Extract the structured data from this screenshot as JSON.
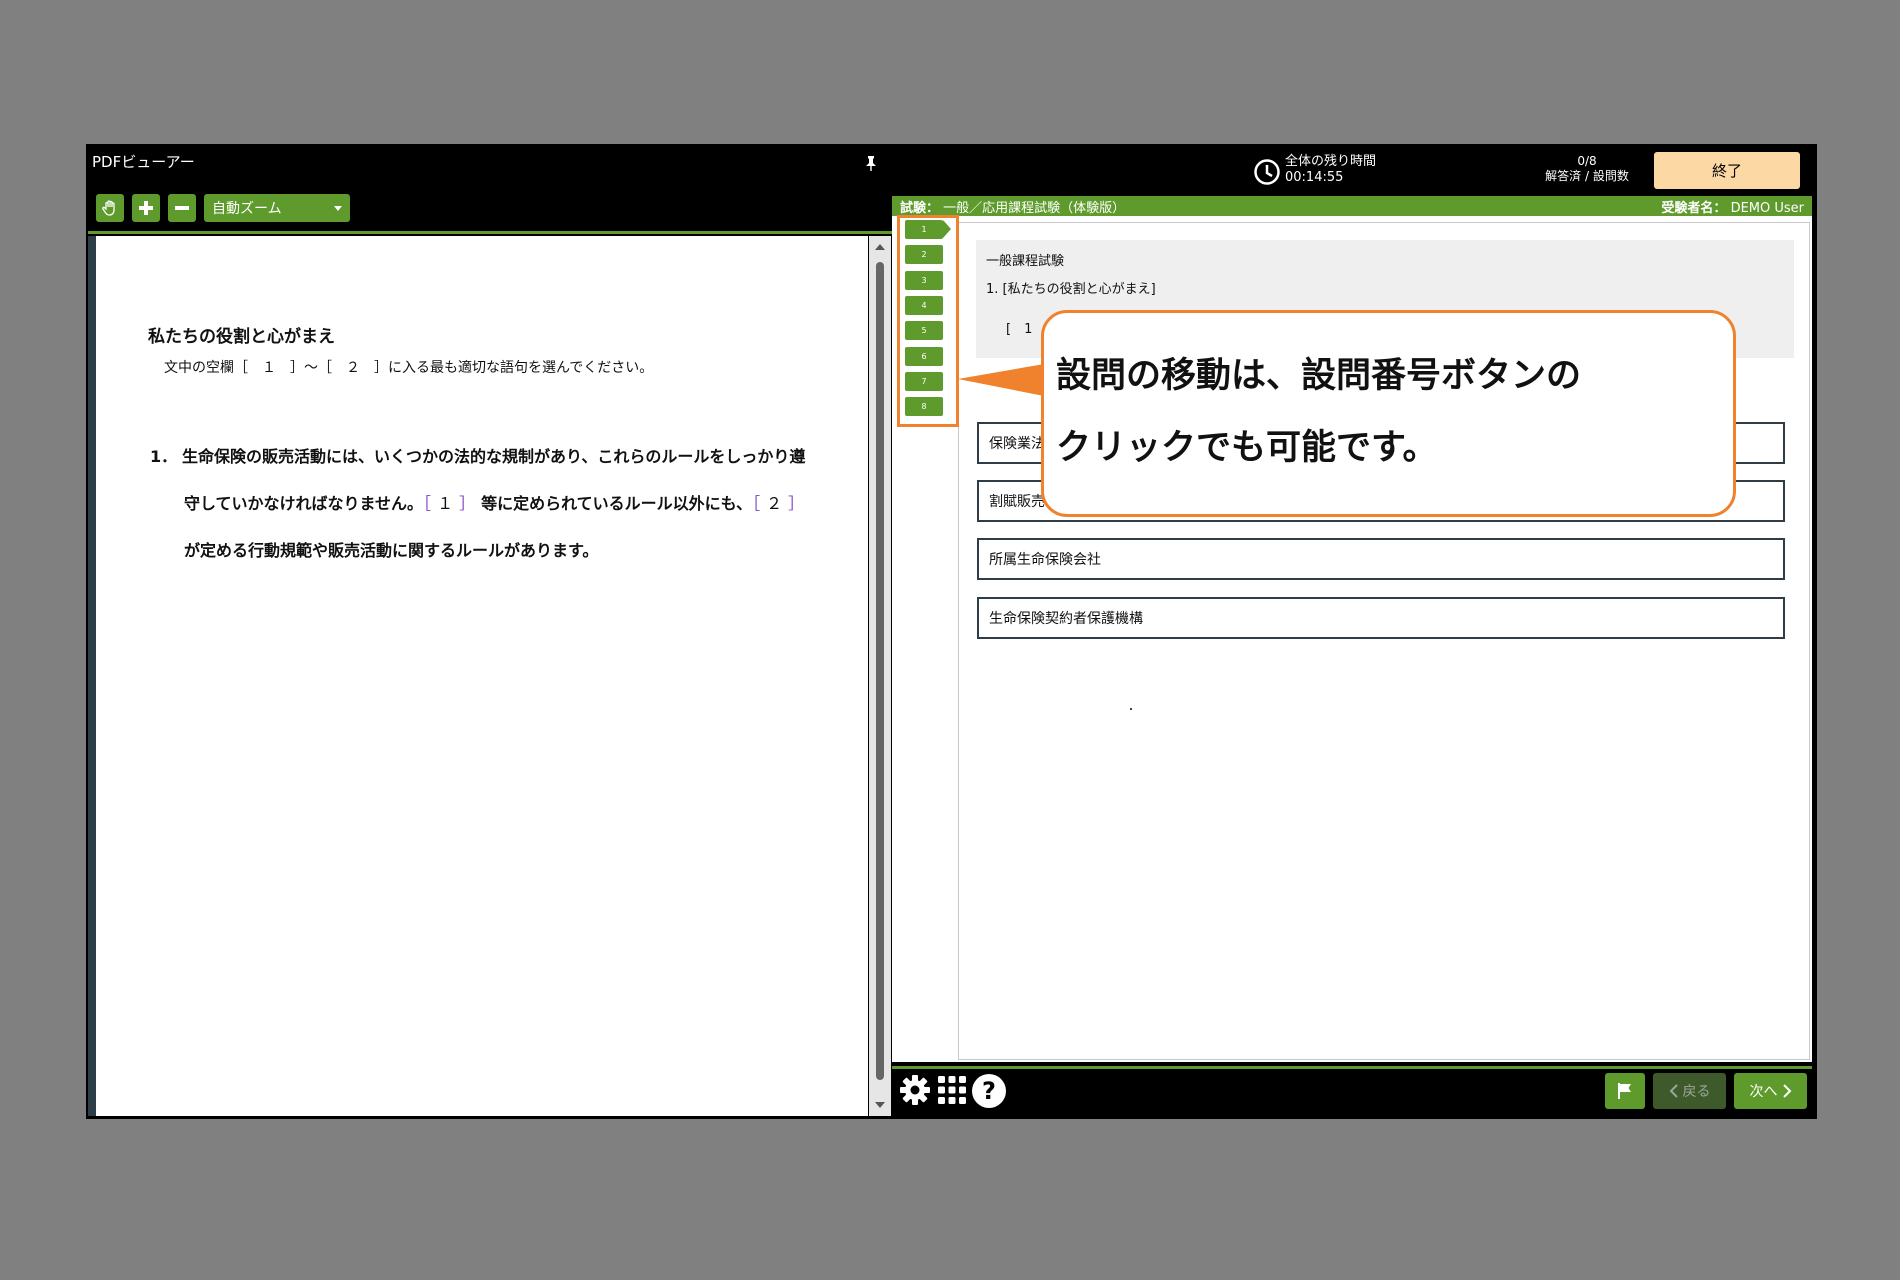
{
  "pdf_viewer": {
    "title": "PDFビューアー",
    "zoom_label": "自動ズーム"
  },
  "document": {
    "heading": "私たちの役割と心がまえ",
    "instruction": "文中の空欄［　１　］～［　２　］に入る最も適切な語句を選んでください。",
    "question_number": "1．",
    "text_part1": "生命保険の販売活動には、いくつかの法的な規制があり、これらのルールをしっかり遵守していかなければなりません。",
    "blank1_open": "［",
    "blank1_num": "１",
    "blank1_close": "］",
    "text_part2": "等に定められているルール以外にも、",
    "blank2_open": "［",
    "blank2_num": "２",
    "blank2_close": "］",
    "text_part3": "が定める行動規範や販売活動に関するルールがあります。"
  },
  "header": {
    "time_label": "全体の残り時間",
    "time_value": "00:14:55",
    "answered_count": "0/8",
    "answered_label": "解答済 / 設問数",
    "end_button": "終了"
  },
  "exam_bar": {
    "exam_label": "試験：",
    "exam_name": "一般／応用課程試験（体験版）",
    "examinee_label": "受験者名：",
    "examinee_name": "DEMO User"
  },
  "question_nav": [
    "1",
    "2",
    "3",
    "4",
    "5",
    "6",
    "7",
    "8"
  ],
  "question": {
    "section": "一般課程試験",
    "title": "1. [私たちの役割と心がまえ]",
    "blank": "[　1"
  },
  "choices": [
    "保険業法",
    "割賦販売",
    "所属生命保険会社",
    "生命保険契約者保護機構"
  ],
  "footer": {
    "back_label": "戻る",
    "next_label": "次へ"
  },
  "callout": {
    "line1": "設問の移動は、設問番号ボタンの",
    "line2": "クリックでも可能です。"
  },
  "colors": {
    "accent_green": "#5e9a2c",
    "end_button": "#fcd9a4",
    "callout_orange": "#f0812d"
  }
}
